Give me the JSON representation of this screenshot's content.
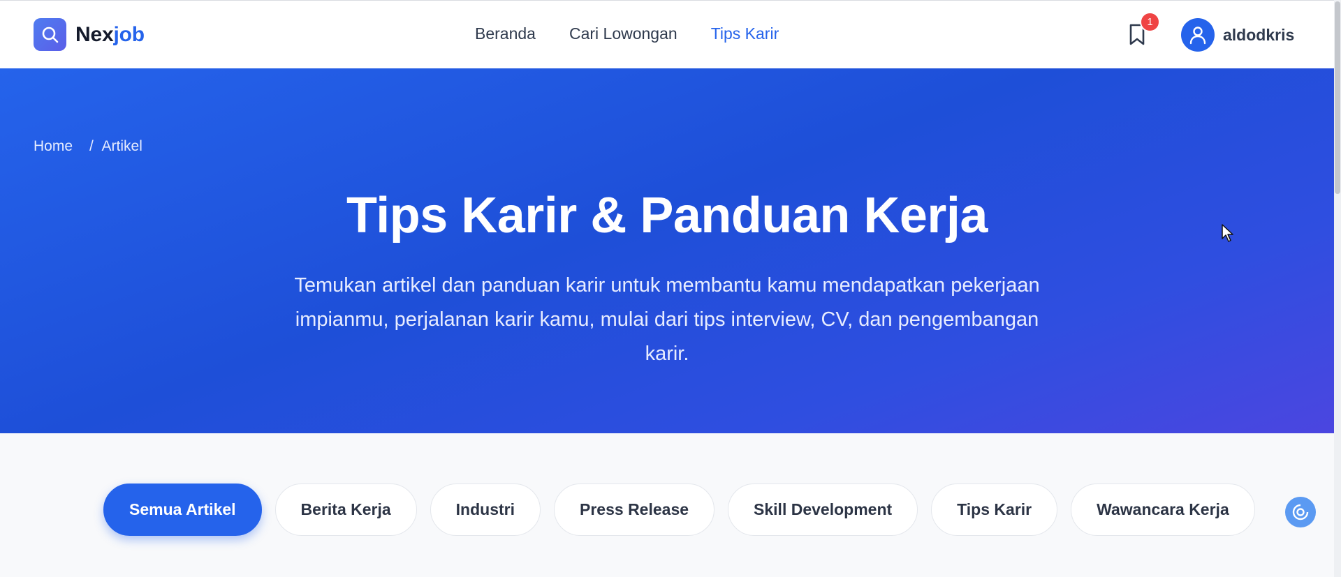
{
  "brand": {
    "part1": "Nex",
    "part2": "job"
  },
  "nav": {
    "items": [
      {
        "label": "Beranda",
        "active": false
      },
      {
        "label": "Cari Lowongan",
        "active": false
      },
      {
        "label": "Tips Karir",
        "active": true
      }
    ]
  },
  "header": {
    "bookmark_count": "1",
    "username": "aldodkris"
  },
  "breadcrumb": {
    "home": "Home",
    "separator": "/",
    "current": "Artikel"
  },
  "hero": {
    "title": "Tips Karir & Panduan Kerja",
    "description": "Temukan artikel dan panduan karir untuk membantu kamu mendapatkan pekerjaan impianmu, perjalanan karir kamu, mulai dari tips interview, CV, dan pengembangan karir."
  },
  "filters": [
    {
      "label": "Semua Artikel",
      "active": true
    },
    {
      "label": "Berita Kerja",
      "active": false
    },
    {
      "label": "Industri",
      "active": false
    },
    {
      "label": "Press Release",
      "active": false
    },
    {
      "label": "Skill Development",
      "active": false
    },
    {
      "label": "Tips Karir",
      "active": false
    },
    {
      "label": "Wawancara Kerja",
      "active": false
    }
  ],
  "icons": {
    "logo": "search-icon",
    "bookmark": "bookmark-icon",
    "avatar": "user-icon",
    "floating": "support-icon"
  },
  "colors": {
    "accent": "#2563eb",
    "badge": "#ef4444",
    "hero_start": "#2563eb",
    "hero_end": "#4b46e0"
  }
}
